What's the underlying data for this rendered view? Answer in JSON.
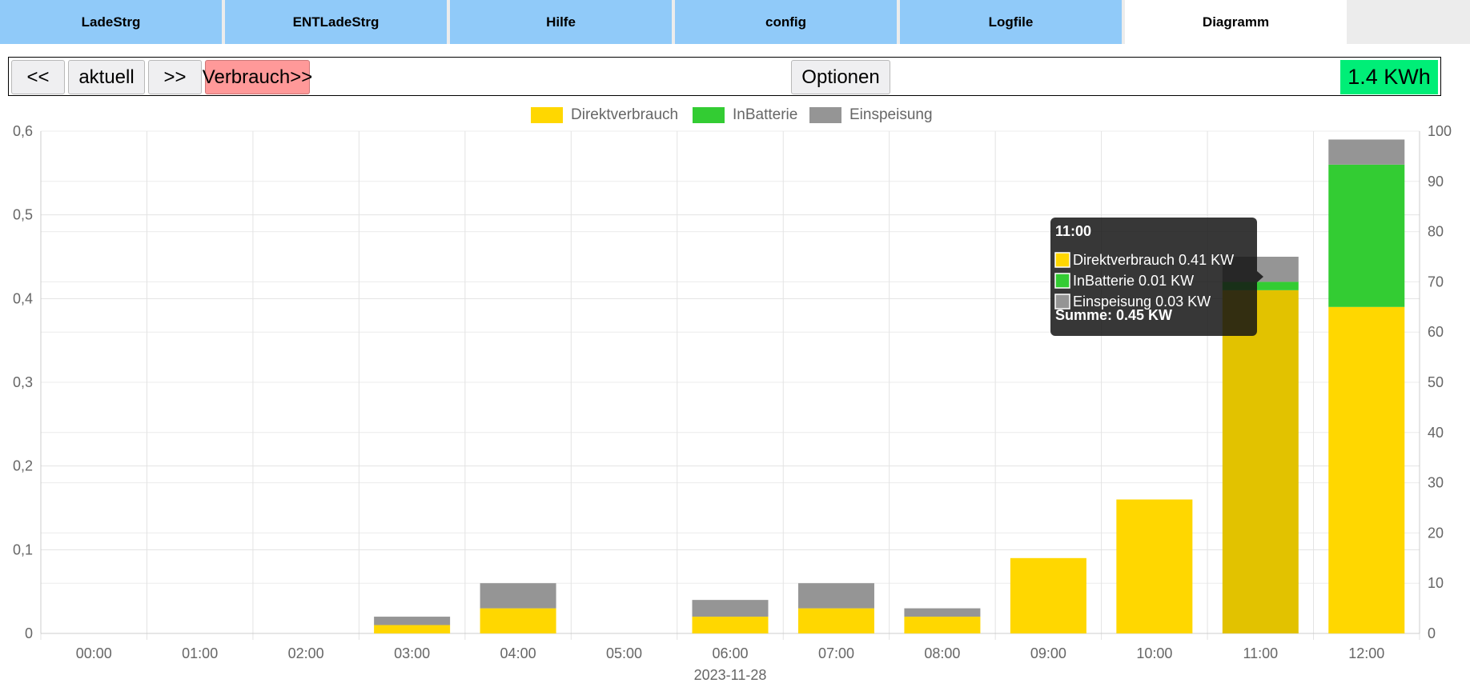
{
  "tabs": [
    {
      "label": "LadeStrg",
      "active": false
    },
    {
      "label": "ENTLadeStrg",
      "active": false
    },
    {
      "label": "Hilfe",
      "active": false
    },
    {
      "label": "config",
      "active": false
    },
    {
      "label": "Logfile",
      "active": false
    },
    {
      "label": "Diagramm",
      "active": true
    }
  ],
  "toolbar": {
    "prev_label": "<<",
    "now_label": "aktuell",
    "next_label": ">>",
    "mode_label": "Verbrauch>>",
    "options_label": "Optionen",
    "total": "1.4 KWh"
  },
  "colors": {
    "tab_bg": "#90caf9",
    "mode_button": "#ff9999",
    "total_badge": "#00ee77",
    "direkt": "#ffd700",
    "batterie": "#33cc33",
    "einspeisung": "#959595"
  },
  "chart_data": {
    "type": "bar",
    "stacked": true,
    "categories": [
      "00:00",
      "01:00",
      "02:00",
      "03:00",
      "04:00",
      "05:00",
      "06:00",
      "07:00",
      "08:00",
      "09:00",
      "10:00",
      "11:00",
      "12:00"
    ],
    "series": [
      {
        "name": "Direktverbrauch",
        "color": "#ffd700",
        "values": [
          0,
          0,
          0,
          0.01,
          0.03,
          0,
          0.02,
          0.03,
          0.02,
          0.09,
          0.16,
          0.41,
          0.39
        ]
      },
      {
        "name": "InBatterie",
        "color": "#33cc33",
        "values": [
          0,
          0,
          0,
          0,
          0,
          0,
          0,
          0,
          0,
          0,
          0,
          0.01,
          0.17
        ]
      },
      {
        "name": "Einspeisung",
        "color": "#959595",
        "values": [
          0,
          0,
          0,
          0.01,
          0.03,
          0,
          0.02,
          0.03,
          0.01,
          0,
          0,
          0.03,
          0.03
        ]
      }
    ],
    "xlabel": "2023-11-28",
    "ylim": [
      0,
      0.6
    ],
    "y_ticks": [
      "0",
      "0,1",
      "0,2",
      "0,3",
      "0,4",
      "0,5",
      "0,6"
    ],
    "y2lim": [
      0,
      100
    ],
    "y2_ticks": [
      "0",
      "10",
      "20",
      "30",
      "40",
      "50",
      "60",
      "70",
      "80",
      "90",
      "100"
    ],
    "legend_position": "top-center",
    "grid": true,
    "tooltip": {
      "category_index": 11,
      "title": "11:00",
      "lines": [
        "Direktverbrauch 0.41 KW",
        "InBatterie 0.01 KW",
        "Einspeisung 0.03 KW"
      ],
      "footer": "Summe: 0.45 KW"
    }
  }
}
